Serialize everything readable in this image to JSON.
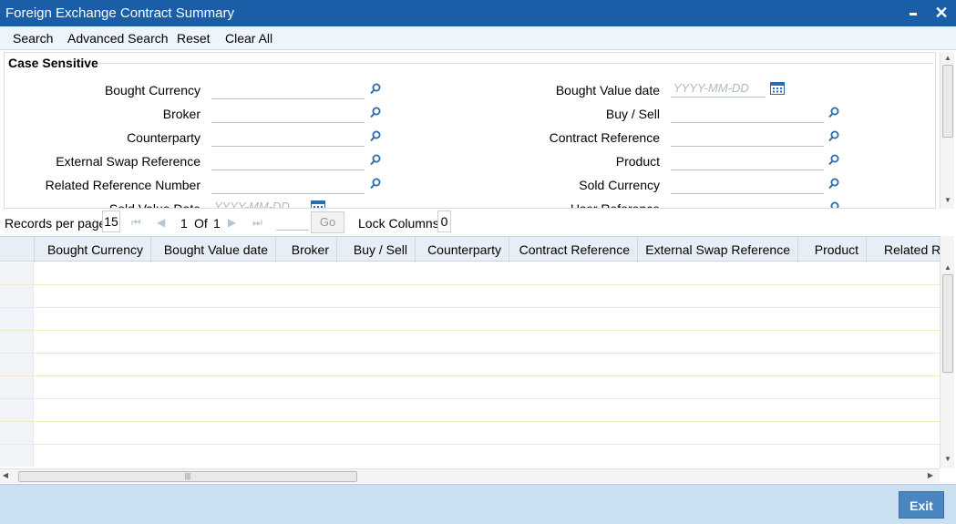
{
  "window": {
    "title": "Foreign Exchange Contract Summary"
  },
  "toolbar": {
    "search": "Search",
    "advanced_search": "Advanced Search",
    "reset": "Reset",
    "clear_all": "Clear All"
  },
  "search_panel": {
    "legend": "Case Sensitive",
    "left_fields": [
      {
        "label": "Bought Currency",
        "type": "lov"
      },
      {
        "label": "Broker",
        "type": "lov"
      },
      {
        "label": "Counterparty",
        "type": "lov"
      },
      {
        "label": "External Swap Reference",
        "type": "lov"
      },
      {
        "label": "Related Reference Number",
        "type": "lov"
      },
      {
        "label": "Sold Value Date",
        "type": "date",
        "placeholder": "YYYY-MM-DD"
      }
    ],
    "right_fields": [
      {
        "label": "Bought Value date",
        "type": "date",
        "placeholder": "YYYY-MM-DD"
      },
      {
        "label": "Buy / Sell",
        "type": "lov"
      },
      {
        "label": "Contract Reference",
        "type": "lov"
      },
      {
        "label": "Product",
        "type": "lov"
      },
      {
        "label": "Sold Currency",
        "type": "lov"
      },
      {
        "label": "User Reference",
        "type": "lov"
      }
    ]
  },
  "pager": {
    "records_label": "Records per page",
    "records_value": "15",
    "current_page": "1",
    "of_label": "Of",
    "total_pages": "1",
    "go_label": "Go",
    "lock_label": "Lock Columns",
    "lock_value": "0"
  },
  "grid": {
    "columns": [
      "Bought Currency",
      "Bought Value date",
      "Broker",
      "Buy / Sell",
      "Counterparty",
      "Contract Reference",
      "External Swap Reference",
      "Product",
      "Related R"
    ],
    "row_count": 9
  },
  "footer": {
    "exit_label": "Exit"
  },
  "icons": {
    "search": "magnifier-icon",
    "calendar": "calendar-icon"
  },
  "colors": {
    "titlebar": "#1a5ea8",
    "footer": "#cadff0",
    "exit_button": "#4a86c0",
    "lov_icon": "#2b6cb0"
  }
}
